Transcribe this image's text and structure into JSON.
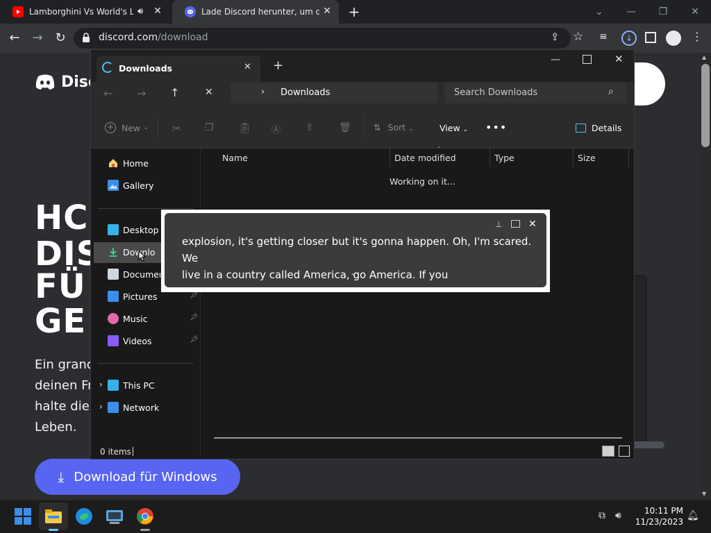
{
  "browser": {
    "tabs": [
      {
        "title": "Lamborghini Vs World's Larg",
        "favicon": "youtube-icon"
      },
      {
        "title": "Lade Discord herunter, um dich",
        "favicon": "discord-icon"
      }
    ],
    "url_host": "discord.com",
    "url_path": "/download"
  },
  "discord_page": {
    "logo_text": "Disc",
    "hero_lines": [
      "HC",
      "DIS",
      "FÜ",
      "GE"
    ],
    "paragraph_lines": [
      "Ein grand",
      "deinen Fr",
      "halte die l",
      "Leben."
    ],
    "download_button": "Download für Windows"
  },
  "explorer": {
    "tab_title": "Downloads",
    "breadcrumb": "Downloads",
    "search_placeholder": "Search Downloads",
    "commands": {
      "new": "New",
      "sort": "Sort",
      "view": "View",
      "details": "Details"
    },
    "sidebar": {
      "quick": [
        {
          "label": "Home",
          "icon": "home-icon"
        },
        {
          "label": "Gallery",
          "icon": "gallery-icon"
        }
      ],
      "pinned": [
        {
          "label": "Desktop",
          "icon": "desktop-icon"
        },
        {
          "label": "Downloads",
          "icon": "downloads-icon"
        },
        {
          "label": "Documents",
          "icon": "documents-icon"
        },
        {
          "label": "Pictures",
          "icon": "pictures-icon"
        },
        {
          "label": "Music",
          "icon": "music-icon"
        },
        {
          "label": "Videos",
          "icon": "videos-icon"
        }
      ],
      "tree": [
        {
          "label": "This PC",
          "icon": "pc-icon"
        },
        {
          "label": "Network",
          "icon": "network-icon"
        }
      ]
    },
    "columns": [
      "Name",
      "Date modified",
      "Type",
      "Size"
    ],
    "status_message": "Working on it...",
    "item_count": "0 items"
  },
  "live_caption": {
    "line1": "explosion, it's getting closer but it's gonna happen. Oh, I'm scared. We",
    "line2": "live in a country called America, go America. If you"
  },
  "taskbar": {
    "time": "10:11 PM",
    "date": "11/23/2023"
  },
  "colors": {
    "discord_blurple": "#5865f2",
    "youtube_red": "#ff0000",
    "windows_blue": "#3b8eea"
  }
}
